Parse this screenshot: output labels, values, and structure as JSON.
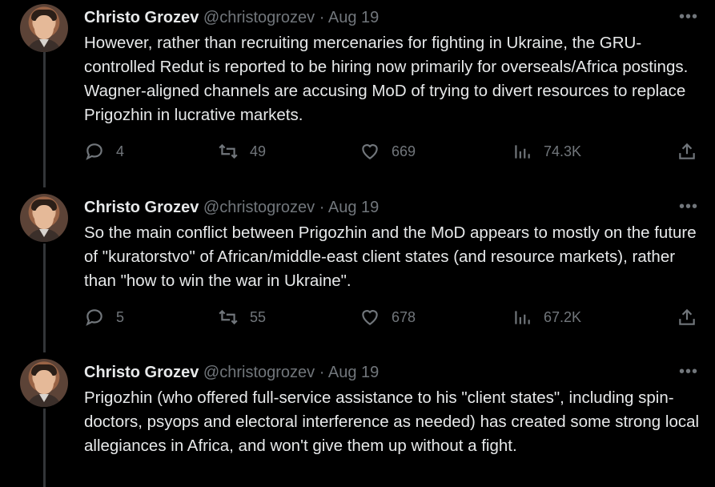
{
  "tweets": [
    {
      "author_name": "Christo Grozev",
      "handle": "@christogrozev",
      "separator": "·",
      "date": "Aug 19",
      "more": "•••",
      "text": "However, rather than recruiting mercenaries for  fighting in Ukraine, the GRU-controlled Redut is reported to be hiring now primarily for overseals/Africa postings. Wagner-aligned channels are accusing MoD of trying to divert resources to replace Prigozhin in lucrative markets.",
      "replies": "4",
      "retweets": "49",
      "likes": "669",
      "views": "74.3K"
    },
    {
      "author_name": "Christo Grozev",
      "handle": "@christogrozev",
      "separator": "·",
      "date": "Aug 19",
      "more": "•••",
      "text": "So the main conflict between Prigozhin and the MoD appears to mostly on the future of \"kuratorstvo\" of African/middle-east client states (and resource markets), rather than \"how to win the war in Ukraine\".",
      "replies": "5",
      "retweets": "55",
      "likes": "678",
      "views": "67.2K"
    },
    {
      "author_name": "Christo Grozev",
      "handle": "@christogrozev",
      "separator": "·",
      "date": "Aug 19",
      "more": "•••",
      "text": "Prigozhin (who offered full-service assistance to his \"client states\", including spin-doctors, psyops and electoral interference as needed) has created some strong local allegiances in Africa, and won't give them up without a fight."
    }
  ],
  "icons": {
    "reply": "reply-icon",
    "retweet": "retweet-icon",
    "like": "heart-icon",
    "views": "views-icon",
    "share": "share-icon"
  },
  "colors": {
    "background": "#000000",
    "text_primary": "#e7e9ea",
    "text_secondary": "#71767b",
    "thread_line": "#333639"
  }
}
